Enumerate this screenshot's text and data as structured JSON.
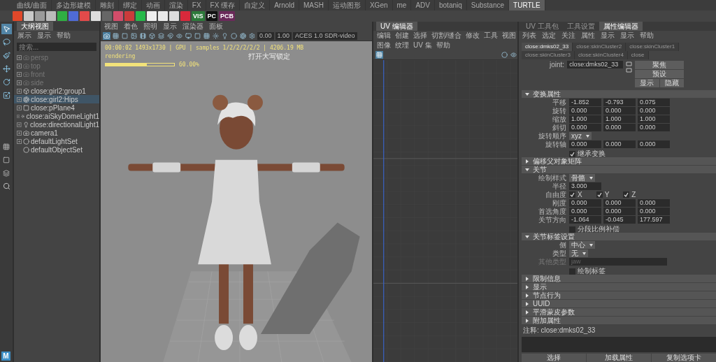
{
  "shelf": {
    "tabs": [
      {
        "label": "曲线/曲面",
        "selected": false
      },
      {
        "label": "多边形建模",
        "selected": false
      },
      {
        "label": "雕刻",
        "selected": false
      },
      {
        "label": "绑定",
        "selected": false
      },
      {
        "label": "动画",
        "selected": false
      },
      {
        "label": "渲染",
        "selected": false
      },
      {
        "label": "FX",
        "selected": false
      },
      {
        "label": "FX 缓存",
        "selected": false
      },
      {
        "label": "自定义",
        "selected": false
      },
      {
        "label": "Arnold",
        "selected": false
      },
      {
        "label": "MASH",
        "selected": false
      },
      {
        "label": "运动图形",
        "selected": false
      },
      {
        "label": "XGen",
        "selected": false
      },
      {
        "label": "me",
        "selected": false
      },
      {
        "label": "ADV",
        "selected": false
      },
      {
        "label": "botaniq",
        "selected": false
      },
      {
        "label": "Substance",
        "selected": false
      },
      {
        "label": "TURTLE",
        "selected": true
      }
    ],
    "icon_labels": [
      "VIS",
      "PC",
      "PCB"
    ]
  },
  "toolbox": {
    "logo": "M"
  },
  "outliner": {
    "tab": "大纲视图",
    "menu": [
      "展示",
      "显示",
      "帮助"
    ],
    "search": {
      "placeholder": "搜索..."
    },
    "items": [
      {
        "label": "persp",
        "kind": "camera",
        "dimmed": true,
        "expandable": true,
        "selected": false
      },
      {
        "label": "top",
        "kind": "camera",
        "dimmed": true,
        "expandable": true,
        "selected": false
      },
      {
        "label": "front",
        "kind": "camera",
        "dimmed": true,
        "expandable": true,
        "selected": false
      },
      {
        "label": "side",
        "kind": "camera",
        "dimmed": true,
        "expandable": true,
        "selected": false
      },
      {
        "label": "close:girl2:group1",
        "kind": "mesh",
        "dimmed": false,
        "expandable": true,
        "selected": false
      },
      {
        "label": "close:girl2:Hips",
        "kind": "joint",
        "dimmed": false,
        "expandable": true,
        "selected": true
      },
      {
        "label": "close:pPlane4",
        "kind": "plane",
        "dimmed": false,
        "expandable": true,
        "selected": false
      },
      {
        "label": "close:aiSkyDomeLight1",
        "kind": "light",
        "dimmed": false,
        "expandable": true,
        "selected": false
      },
      {
        "label": "close:directionalLight1",
        "kind": "sun",
        "dimmed": false,
        "expandable": true,
        "selected": false
      },
      {
        "label": "camera1",
        "kind": "camera",
        "dimmed": false,
        "expandable": true,
        "selected": false
      },
      {
        "label": "defaultLightSet",
        "kind": "set",
        "dimmed": false,
        "expandable": true,
        "selected": false
      },
      {
        "label": "defaultObjectSet",
        "kind": "set",
        "dimmed": false,
        "expandable": false,
        "selected": false
      }
    ]
  },
  "viewport": {
    "menu": [
      "视图",
      "着色",
      "照明",
      "显示",
      "渲染器",
      "面板"
    ],
    "exposure": "0.00",
    "gamma": "1.00",
    "color_space": "ACES 1.0 SDR-video",
    "render_stats": "00:00:02 1493x1730 | GPU | samples 1/2/2/2/2/2 | 4206.19 MB",
    "render_status": "rendering",
    "progress": {
      "level": 0.6,
      "reading": "60.00%"
    },
    "notice": "打开大写锁定"
  },
  "uv_editor": {
    "tab": "UV 编辑器",
    "menu": [
      "编辑",
      "创建",
      "选择",
      "切割/缝合",
      "修改",
      "工具",
      "视图",
      "图像",
      "纹理",
      "UV 集",
      "帮助"
    ]
  },
  "attribute_editor": {
    "tabs": [
      {
        "label": "UV 工具包",
        "selected": false
      },
      {
        "label": "工具设置",
        "selected": false
      },
      {
        "label": "属性编辑器",
        "selected": true
      }
    ],
    "menu": [
      "列表",
      "选定",
      "关注",
      "属性",
      "显示",
      "显示",
      "帮助"
    ],
    "node_tabs": [
      {
        "label": "close:dmks02_33",
        "selected": true
      },
      {
        "label": "close:skinCluster2",
        "selected": false
      },
      {
        "label": "close:skinCluster1",
        "selected": false
      },
      {
        "label": "close:skinCluster3",
        "selected": false
      },
      {
        "label": "close:skinCluster4",
        "selected": false
      },
      {
        "label": "close",
        "selected": false
      }
    ],
    "node": {
      "label": "joint:",
      "value": "close:dmks02_33",
      "buttons": [
        "聚焦",
        "预设",
        "显示",
        "隐藏"
      ]
    },
    "sections": [
      {
        "title": "变换属性",
        "expanded": true,
        "rows": [
          {
            "kind": "vector",
            "label": "平移",
            "values": [
              "-1.852",
              "-0.793",
              "0.075"
            ]
          },
          {
            "kind": "vector",
            "label": "旋转",
            "values": [
              "0.000",
              "0.000",
              "0.000"
            ]
          },
          {
            "kind": "vector",
            "label": "缩放",
            "values": [
              "1.000",
              "1.000",
              "1.000"
            ]
          },
          {
            "kind": "vector",
            "label": "斜切",
            "values": [
              "0.000",
              "0.000",
              "0.000"
            ]
          },
          {
            "kind": "dropdown",
            "label": "旋转顺序",
            "value": "xyz"
          },
          {
            "kind": "vector",
            "label": "旋转轴",
            "values": [
              "0.000",
              "0.000",
              "0.000"
            ]
          },
          {
            "kind": "checkbox",
            "label": "继承变换",
            "checked": true
          }
        ]
      },
      {
        "title": "偏移父对象矩阵",
        "expanded": false
      },
      {
        "title": "关节",
        "expanded": true,
        "rows": [
          {
            "kind": "dropdown",
            "label": "绘制样式",
            "value": "骨骼"
          },
          {
            "kind": "vector",
            "label": "半径",
            "values": [
              "3.000"
            ]
          },
          {
            "kind": "checks",
            "label": "自由度",
            "items": [
              {
                "label": "X",
                "checked": true
              },
              {
                "label": "Y",
                "checked": true
              },
              {
                "label": "Z",
                "checked": true
              }
            ]
          },
          {
            "kind": "vector",
            "label": "刚度",
            "values": [
              "0.000",
              "0.000",
              "0.000"
            ]
          },
          {
            "kind": "vector",
            "label": "首选角度",
            "values": [
              "0.000",
              "0.000",
              "0.000"
            ]
          },
          {
            "kind": "vector",
            "label": "关节方向",
            "values": [
              "-1.064",
              "-0.045",
              "177.597"
            ]
          },
          {
            "kind": "checkbox",
            "label": "分段比例补偿",
            "checked": false
          }
        ]
      },
      {
        "title": "关节标签设置",
        "expanded": true,
        "rows": [
          {
            "kind": "dropdown",
            "label": "侧",
            "value": "中心"
          },
          {
            "kind": "dropdown",
            "label": "类型",
            "value": "无"
          },
          {
            "kind": "text",
            "label": "其他类型",
            "value": "jaw",
            "disabled": true
          },
          {
            "kind": "checkbox",
            "label": "绘制标签",
            "checked": false
          }
        ]
      },
      {
        "title": "限制信息",
        "expanded": false
      },
      {
        "title": "显示",
        "expanded": false
      },
      {
        "title": "节点行为",
        "expanded": false
      },
      {
        "title": "UUID",
        "expanded": false
      },
      {
        "title": "平滑蒙皮参数",
        "expanded": false
      },
      {
        "title": "附加属性",
        "expanded": false
      }
    ],
    "notes_label": "注释: close:dmks02_33",
    "buttons": [
      "选择",
      "加载属性",
      "复制选项卡"
    ]
  }
}
